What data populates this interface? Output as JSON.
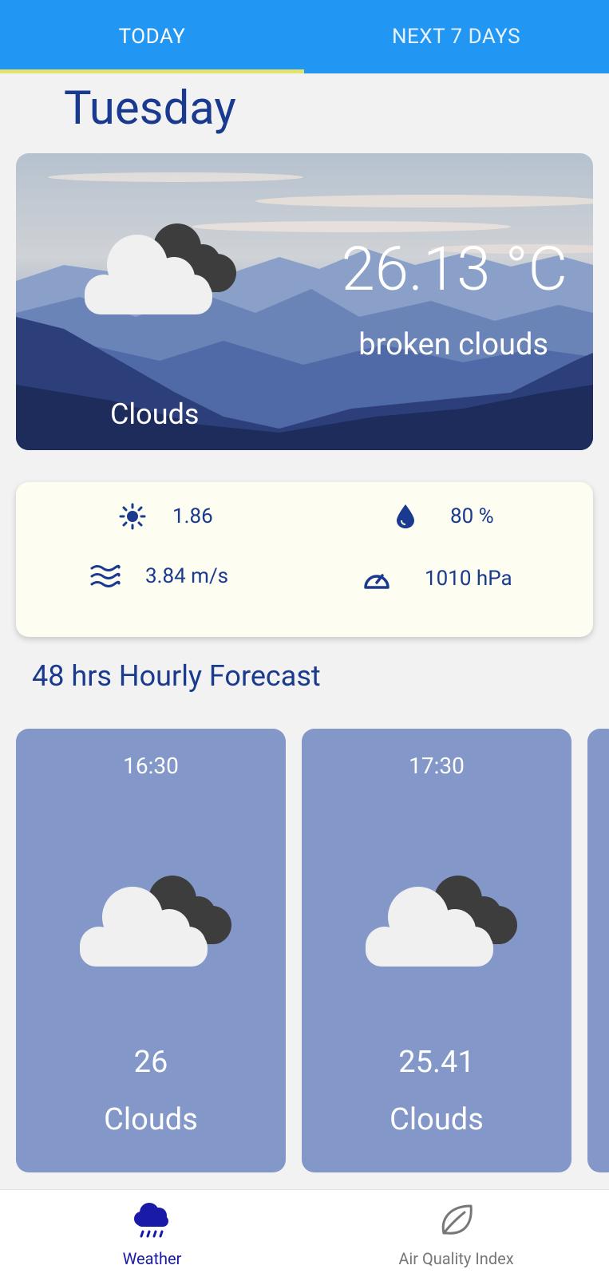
{
  "tabs": {
    "today": "TODAY",
    "next": "NEXT 7 DAYS"
  },
  "day": "Tuesday",
  "current": {
    "temperature": "26.13 °C",
    "description": "broken clouds",
    "condition": "Clouds",
    "icon": "cloud-icon"
  },
  "details": {
    "uv": "1.86",
    "humidity": "80 %",
    "wind": "3.84 m/s",
    "pressure": "1010 hPa"
  },
  "hourly_title": "48 hrs Hourly Forecast",
  "hourly": [
    {
      "time": "16:30",
      "temp": "26",
      "condition": "Clouds"
    },
    {
      "time": "17:30",
      "temp": "25.41",
      "condition": "Clouds"
    }
  ],
  "nav": {
    "weather": "Weather",
    "aqi": "Air Quality Index"
  },
  "colors": {
    "tab_bar": "#2196f3",
    "tab_indicator": "#e3e36a",
    "text_primary": "#1a3a8f",
    "hour_card": "#8397c8",
    "active_nav": "#1a1aa8"
  }
}
